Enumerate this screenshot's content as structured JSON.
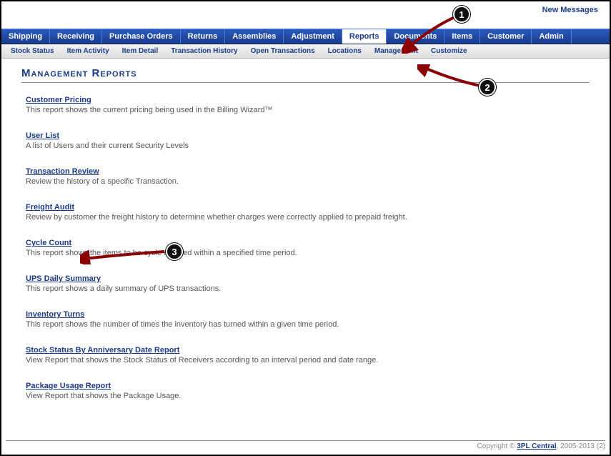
{
  "top_bar": {
    "new_messages": "New Messages"
  },
  "main_nav": [
    "Shipping",
    "Receiving",
    "Purchase Orders",
    "Returns",
    "Assemblies",
    "Adjustment",
    "Reports",
    "Documents",
    "Items",
    "Customer",
    "Admin"
  ],
  "main_nav_active_index": 6,
  "sub_nav": [
    "Stock Status",
    "Item Activity",
    "Item Detail",
    "Transaction History",
    "Open Transactions",
    "Locations",
    "Management",
    "Customize"
  ],
  "page_title": "Management Reports",
  "reports": [
    {
      "name": "Customer Pricing",
      "desc": "This report shows the current pricing being used in the Billing Wizard™"
    },
    {
      "name": "User List",
      "desc": "A list of Users and their current Security Levels"
    },
    {
      "name": "Transaction Review",
      "desc": "Review the history of a specific Transaction."
    },
    {
      "name": "Freight Audit",
      "desc": "Review by customer the freight history to determine whether charges were correctly applied to prepaid freight."
    },
    {
      "name": "Cycle Count",
      "desc": "This report shows the items to be cycle counted within a specified time period."
    },
    {
      "name": "UPS Daily Summary",
      "desc": "This report shows a daily summary of UPS transactions."
    },
    {
      "name": "Inventory Turns",
      "desc": "This report shows the number of times the inventory has turned within a given time period."
    },
    {
      "name": "Stock Status By Anniversary Date Report",
      "desc": "View Report that shows the Stock Status of Receivers according to an interval period and date range."
    },
    {
      "name": "Package Usage Report",
      "desc": "View Report that shows the Package Usage."
    }
  ],
  "footer": {
    "copyright_prefix": "Copyright © ",
    "brand": "3PL Central",
    "years": ", 2005-2013 (2)"
  },
  "annotations": {
    "b1": "1",
    "b2": "2",
    "b3": "3"
  }
}
